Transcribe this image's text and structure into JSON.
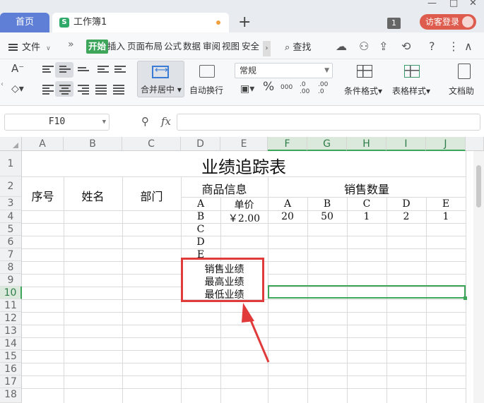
{
  "titlebar": {
    "home_tab": "首页",
    "doc_tab": "工作簿1",
    "doc_icon": "S",
    "new_tab": "+",
    "tab_count": "1",
    "visitor_login": "访客登录",
    "window_controls": [
      "—",
      "□",
      "✕"
    ]
  },
  "menubar": {
    "file_label": "文件",
    "more_glyph": "»",
    "tabs": [
      "开始",
      "插入",
      "页面布局",
      "公式",
      "数据",
      "审阅",
      "视图",
      "安全"
    ],
    "active_tab": "开始",
    "search_label": "查找"
  },
  "ribbon": {
    "merge_center": "合并居中",
    "wrap_text": "自动换行",
    "number_format": "常规",
    "percent": "%",
    "thousands": "000",
    "inc_decimal": ".0 .00",
    "dec_decimal": ".00 .0",
    "conditional_format": "条件格式",
    "table_style": "表格样式",
    "doc_assist": "文档助"
  },
  "formula_bar": {
    "cell_ref": "F10",
    "fx": "fx",
    "formula": ""
  },
  "sheet": {
    "columns": [
      "A",
      "B",
      "C",
      "D",
      "E",
      "F",
      "G",
      "H",
      "I",
      "J"
    ],
    "rows": [
      "1",
      "2",
      "3",
      "4",
      "5",
      "6",
      "7",
      "8",
      "9",
      "10",
      "11",
      "12",
      "13",
      "14",
      "15",
      "16",
      "17",
      "18"
    ],
    "selected_column": [
      "F",
      "G",
      "H",
      "I",
      "J"
    ],
    "selected_row": "10",
    "title": "业绩追踪表",
    "headers": {
      "seq": "序号",
      "name": "姓名",
      "dept": "部门",
      "product_info": "商品信息",
      "sales_qty": "销售数量",
      "unit_price": "单价"
    },
    "products": [
      "A",
      "B",
      "C",
      "D",
      "E"
    ],
    "qty_products": [
      "A",
      "B",
      "C",
      "D",
      "E"
    ],
    "row4": {
      "price": "￥2.00",
      "qty": [
        "20",
        "50",
        "1",
        "2",
        "1"
      ]
    },
    "summary": [
      "销售业绩",
      "最高业绩",
      "最低业绩"
    ]
  },
  "colors": {
    "accent_green": "#3da65a",
    "annotation_red": "#e03a3a",
    "home_tab_blue": "#5f7fd6",
    "visitor_red": "#dd5c4e"
  }
}
